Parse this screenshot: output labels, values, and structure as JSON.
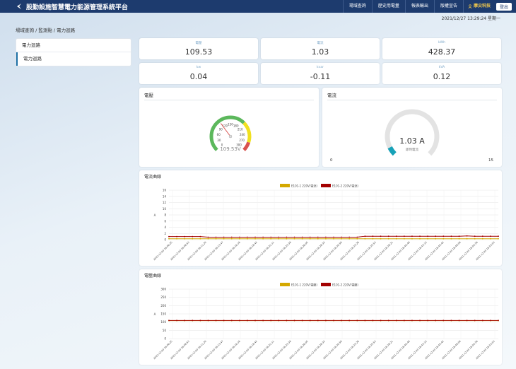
{
  "app": {
    "title": "股勤設施智慧電力能源管理系統平台"
  },
  "nav": {
    "items": [
      "場域查詢",
      "歷史用電量",
      "報表輸出",
      "版權宣告"
    ],
    "user": "摩尖科技",
    "logout": "登出"
  },
  "datetime": "2021/12/27  13:29:24  星期一",
  "breadcrumb": "場域查詢 / 監測點 / 電力迴路",
  "sidebar": {
    "items": [
      "電力迴路",
      "電力迴路"
    ]
  },
  "metrics": [
    {
      "label": "電壓",
      "value": "109.53"
    },
    {
      "label": "電流",
      "value": "1.03"
    },
    {
      "label": "kWh",
      "value": "428.37"
    },
    {
      "label": "kw",
      "value": "0.04"
    },
    {
      "label": "kvar",
      "value": "-0.11"
    },
    {
      "label": "kVA",
      "value": "0.12"
    }
  ],
  "voltage_panel": {
    "title": "電壓",
    "reading": "109.53V",
    "value": 109.53,
    "ticks": [
      "0",
      "30",
      "60",
      "90",
      "120",
      "150",
      "180",
      "210",
      "240",
      "270",
      "300"
    ]
  },
  "current_panel": {
    "title": "電流",
    "reading": "1.03 A",
    "sub": "即時電流",
    "value": 1.03,
    "min": "0",
    "max": "15"
  },
  "colors": {
    "accent": "#1d3b6e",
    "series1": "#d4a800",
    "series2": "#a30000",
    "gauge_green": "#5cb85c",
    "gauge_yellow": "#f0e020",
    "gauge_red": "#d9534f",
    "current_fill": "#17a2b8"
  },
  "chart_data": [
    {
      "type": "line",
      "title": "電流曲線",
      "ylabel": "A",
      "ylim": [
        0,
        16
      ],
      "yticks": [
        "0",
        "2",
        "4",
        "6",
        "8",
        "10",
        "12",
        "14",
        "16"
      ],
      "categories": [
        "2021-12-20 16:06:25",
        "2021-12-20 16:08:53",
        "2021-12-20 16:11:20",
        "2021-12-20 16:13:47",
        "2021-12-20 16:16:16",
        "2021-12-20 16:18:42",
        "2021-12-20 16:21:11",
        "2021-12-20 16:23:38",
        "2021-12-20 16:26:05",
        "2021-12-20 16:28:32",
        "2021-12-20 16:30:59",
        "2021-12-20 16:33:26",
        "2021-12-20 16:35:53",
        "2021-12-20 16:38:21",
        "2021-12-20 16:40:48",
        "2021-12-20 16:43:15",
        "2021-12-20 16:45:42",
        "2021-12-20 16:48:09",
        "2021-12-20 16:50:36",
        "2021-12-20 16:53:03"
      ],
      "series": [
        {
          "name": "E101-1 220V(電流)",
          "values": [
            0.3,
            0.3,
            0.3,
            0.3,
            0.3,
            0.3,
            0.3,
            0.3,
            0.3,
            0.3,
            0.3,
            0.3,
            0.3,
            0.3,
            0.3,
            0.3,
            0.3,
            0.3,
            0.3,
            0.3,
            0.3,
            0.3,
            0.3,
            0.3,
            0.3,
            0.3,
            0.3,
            0.3,
            0.3,
            0.3,
            0.3,
            0.3,
            0.3,
            0.3,
            0.3,
            0.3,
            0.3,
            0.3,
            0.3,
            0.3,
            0.3,
            0.3,
            0.3
          ]
        },
        {
          "name": "E101-2 220V(電流)",
          "values": [
            1.0,
            1.0,
            1.0,
            1.0,
            1.0,
            0.8,
            0.8,
            0.8,
            0.8,
            0.8,
            0.8,
            0.8,
            0.8,
            0.8,
            0.8,
            0.8,
            0.8,
            0.8,
            0.8,
            0.8,
            0.8,
            0.8,
            0.8,
            0.8,
            0.8,
            1.1,
            1.1,
            1.1,
            1.1,
            1.1,
            1.1,
            1.1,
            1.1,
            1.1,
            1.1,
            1.1,
            1.1,
            1.1,
            1.2,
            1.1,
            1.1,
            1.1,
            1.1
          ]
        }
      ]
    },
    {
      "type": "line",
      "title": "電壓曲線",
      "ylabel": "A",
      "ylim": [
        0,
        300
      ],
      "yticks": [
        "0",
        "50",
        "100",
        "150",
        "200",
        "250",
        "300"
      ],
      "categories": [
        "2021-12-20 16:06:25",
        "2021-12-20 16:08:53",
        "2021-12-20 16:11:20",
        "2021-12-20 16:13:47",
        "2021-12-20 16:16:16",
        "2021-12-20 16:18:42",
        "2021-12-20 16:21:11",
        "2021-12-20 16:23:38",
        "2021-12-20 16:26:05",
        "2021-12-20 16:28:32",
        "2021-12-20 16:30:59",
        "2021-12-20 16:33:26",
        "2021-12-20 16:35:53",
        "2021-12-20 16:38:21",
        "2021-12-20 16:40:48",
        "2021-12-20 16:43:15",
        "2021-12-20 16:45:42",
        "2021-12-20 16:48:09",
        "2021-12-20 16:50:36",
        "2021-12-20 16:53:03"
      ],
      "series": [
        {
          "name": "E101-1 220V(電壓)",
          "values": [
            109,
            109,
            109,
            109,
            109,
            109,
            109,
            109,
            109,
            109,
            109,
            109,
            109,
            109,
            109,
            109,
            109,
            109,
            109,
            109,
            109,
            109,
            109,
            109,
            109,
            109,
            109,
            109,
            109,
            109,
            109,
            109,
            109,
            109,
            109,
            109,
            109,
            109,
            109,
            109,
            109,
            109,
            109
          ]
        },
        {
          "name": "E101-2 220V(電壓)",
          "values": [
            110,
            110,
            110,
            110,
            110,
            110,
            110,
            110,
            110,
            110,
            110,
            110,
            110,
            110,
            110,
            110,
            110,
            110,
            110,
            110,
            110,
            110,
            110,
            110,
            110,
            110,
            110,
            110,
            110,
            110,
            110,
            110,
            110,
            110,
            110,
            110,
            110,
            110,
            110,
            110,
            110,
            110,
            110
          ]
        }
      ]
    }
  ]
}
